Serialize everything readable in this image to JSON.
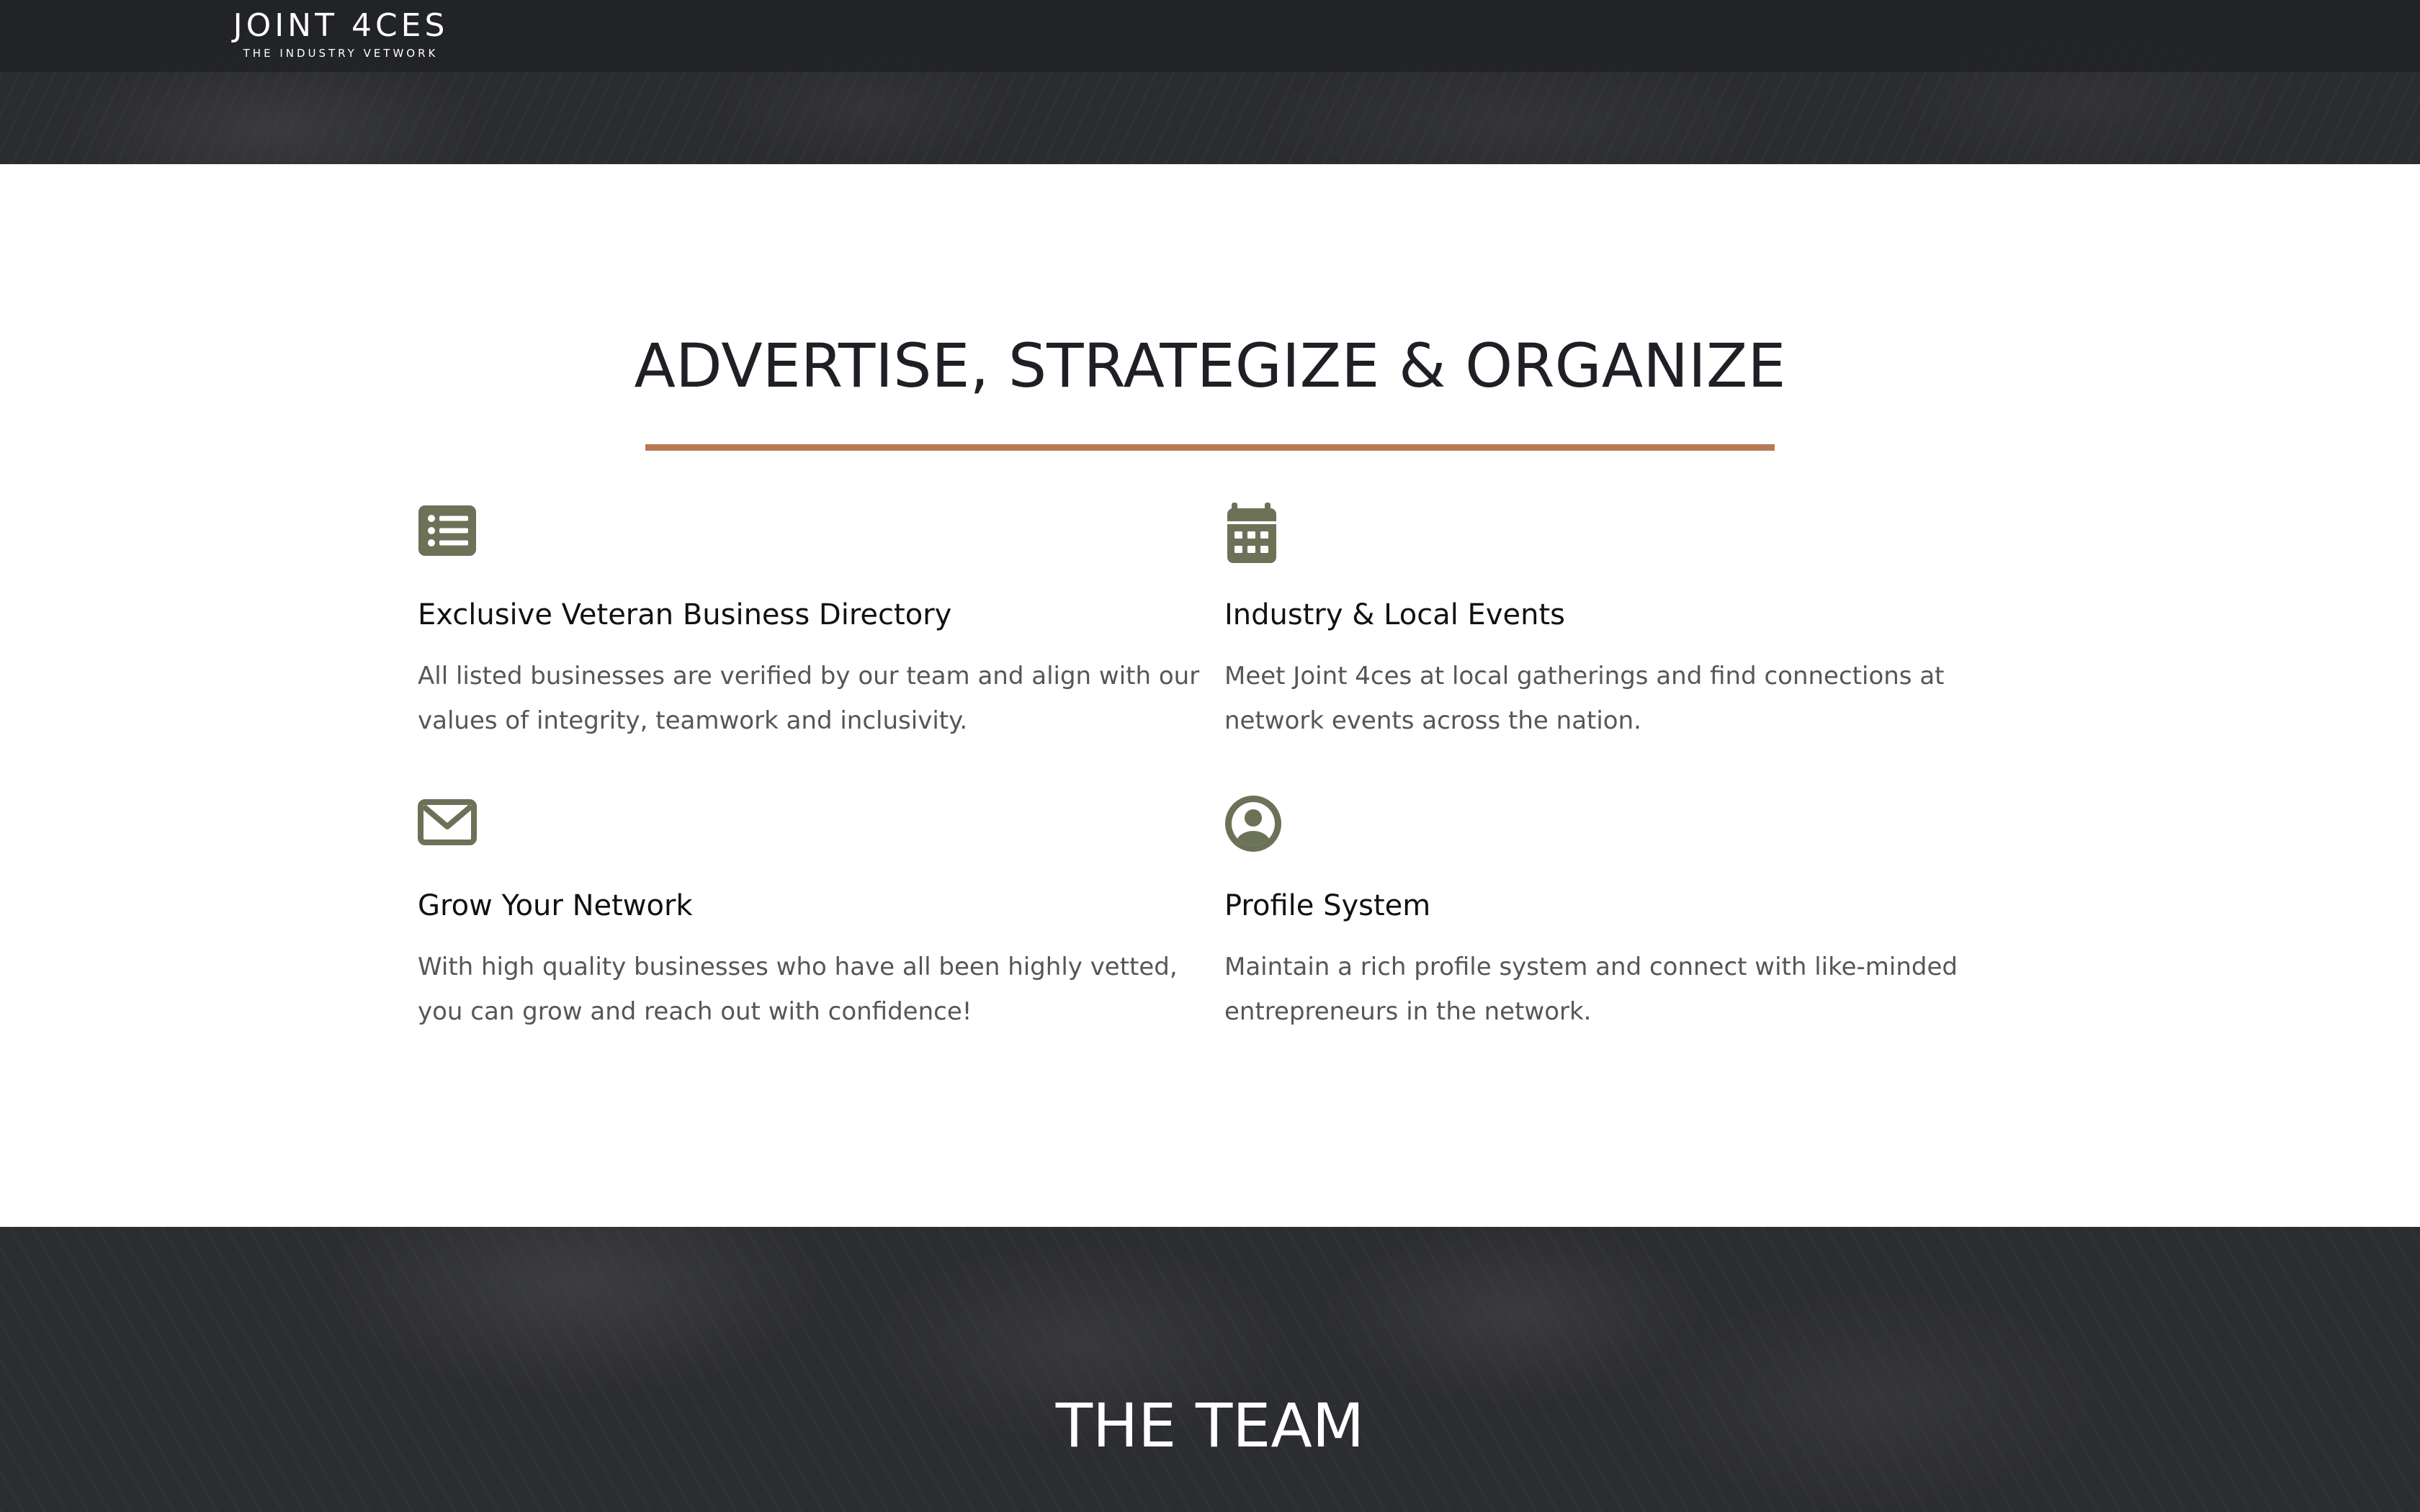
{
  "brand": {
    "name": "JOINT 4CES",
    "tagline": "THE INDUSTRY VETWORK"
  },
  "features_section": {
    "title": "ADVERTISE, STRATEGIZE & ORGANIZE",
    "accent_color": "#b87853",
    "icon_color": "#6b7257",
    "items": [
      {
        "icon": "list-icon",
        "title": "Exclusive Veteran Business Directory",
        "text": "All listed businesses are verified by our team and align with our values of integrity, teamwork and inclusivity."
      },
      {
        "icon": "calendar-icon",
        "title": "Industry & Local Events",
        "text": "Meet Joint 4ces at local gatherings and find connections at network events across the nation."
      },
      {
        "icon": "envelope-icon",
        "title": "Grow Your Network",
        "text": "With high quality businesses who have all been highly vetted, you can grow and reach out with confidence!"
      },
      {
        "icon": "user-circle-icon",
        "title": "Profile System",
        "text": "Maintain a rich profile system and connect with like-minded entrepreneurs in the network."
      }
    ]
  },
  "team_section": {
    "title": "THE TEAM"
  }
}
